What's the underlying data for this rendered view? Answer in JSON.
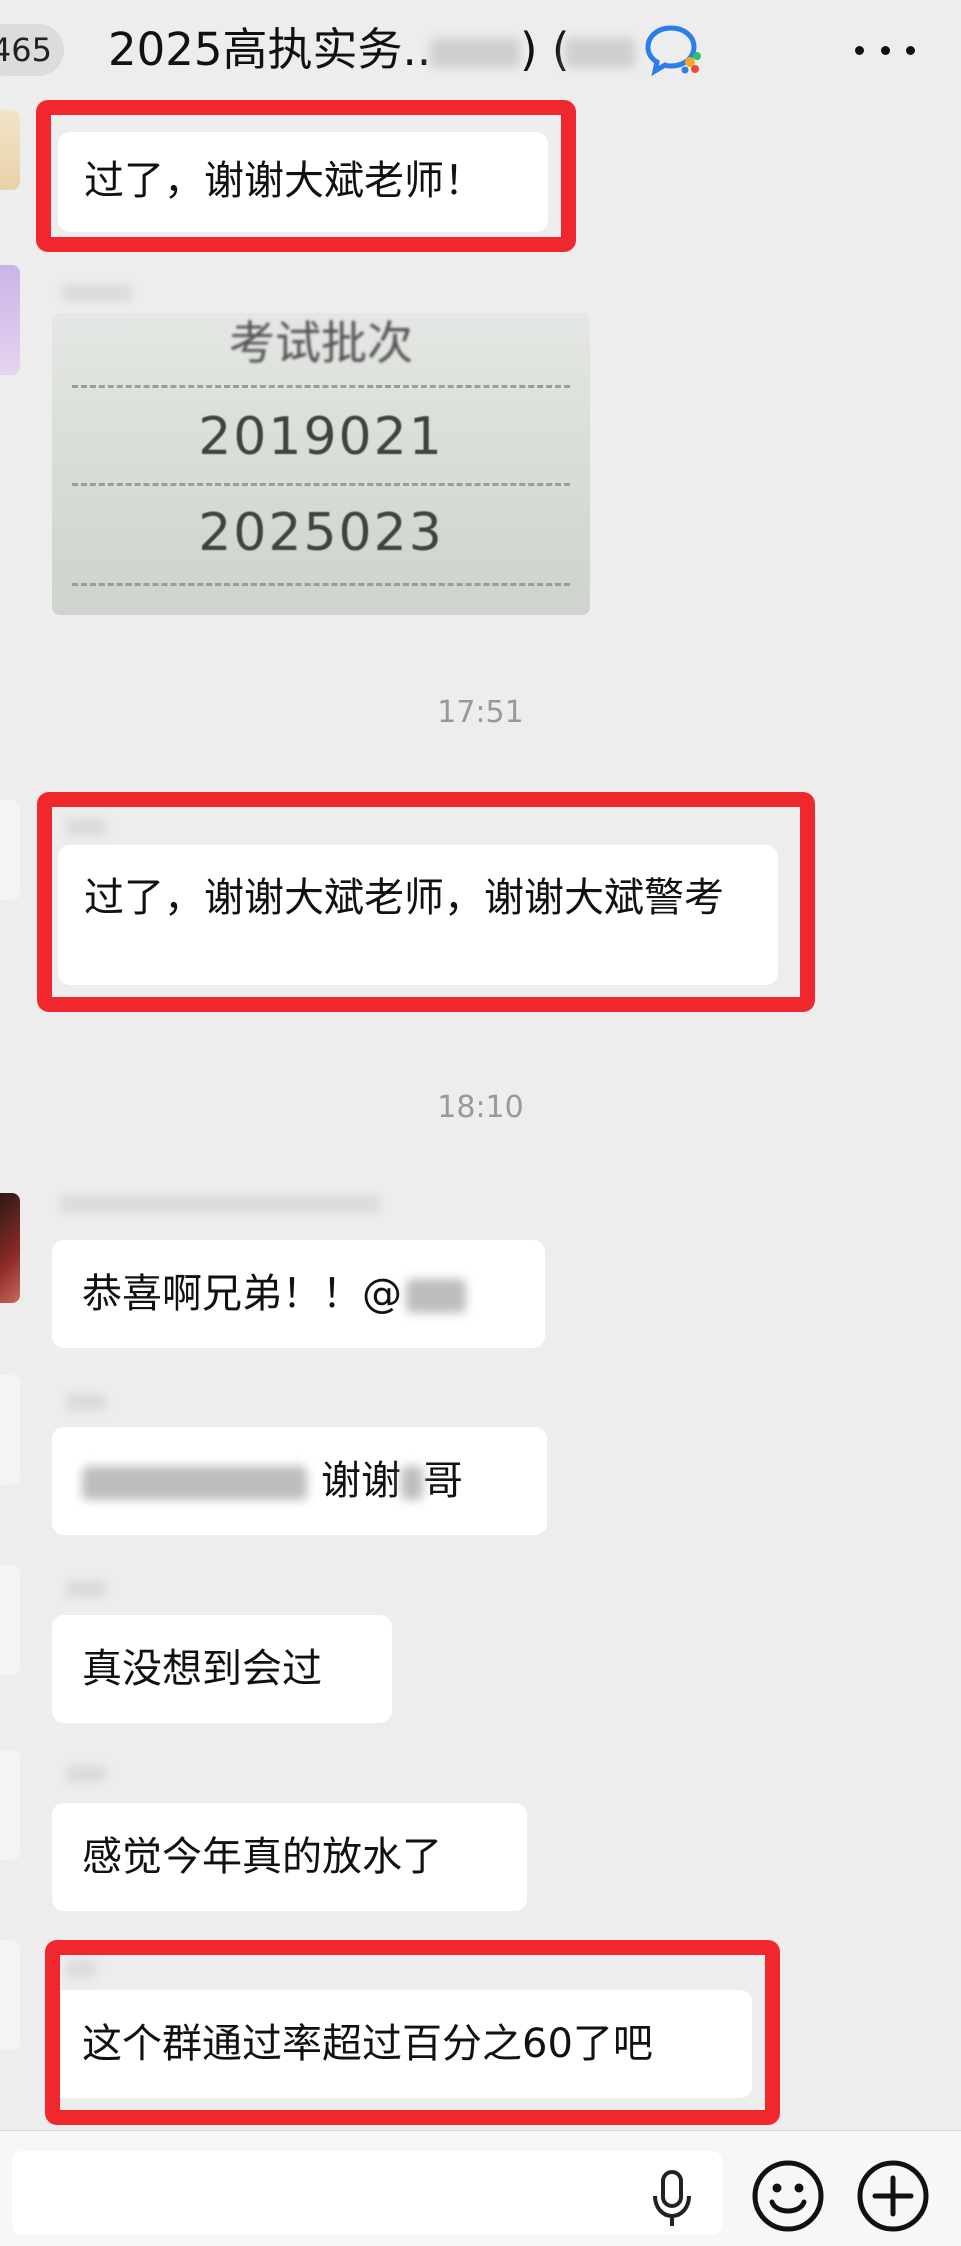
{
  "header": {
    "unread_count": "465",
    "title": "2025高执实务..",
    "title_tail": ") ("
  },
  "messages": [
    {
      "text": "过了，谢谢大斌老师！"
    },
    {
      "image": {
        "header": "考试批次",
        "values": [
          "2019021",
          "2025023"
        ]
      }
    },
    {
      "time": "17:51"
    },
    {
      "text": "过了，谢谢大斌老师，谢谢大斌警考"
    },
    {
      "time": "18:10"
    },
    {
      "text": "恭喜啊兄弟！！@"
    },
    {
      "text": "谢谢",
      "text_tail": "哥"
    },
    {
      "text": "真没想到会过"
    },
    {
      "text": "感觉今年真的放水了"
    },
    {
      "text": "这个群通过率超过百分之60了吧"
    }
  ],
  "colors": {
    "highlight_red": "#f0282d",
    "background": "#ededed",
    "bubble": "#ffffff"
  },
  "icons": {
    "wecom": "wecom-chat-icon",
    "more": "more-dots-icon",
    "voice": "microphone-icon",
    "emoji": "emoji-smile-icon",
    "plus": "plus-circle-icon"
  }
}
